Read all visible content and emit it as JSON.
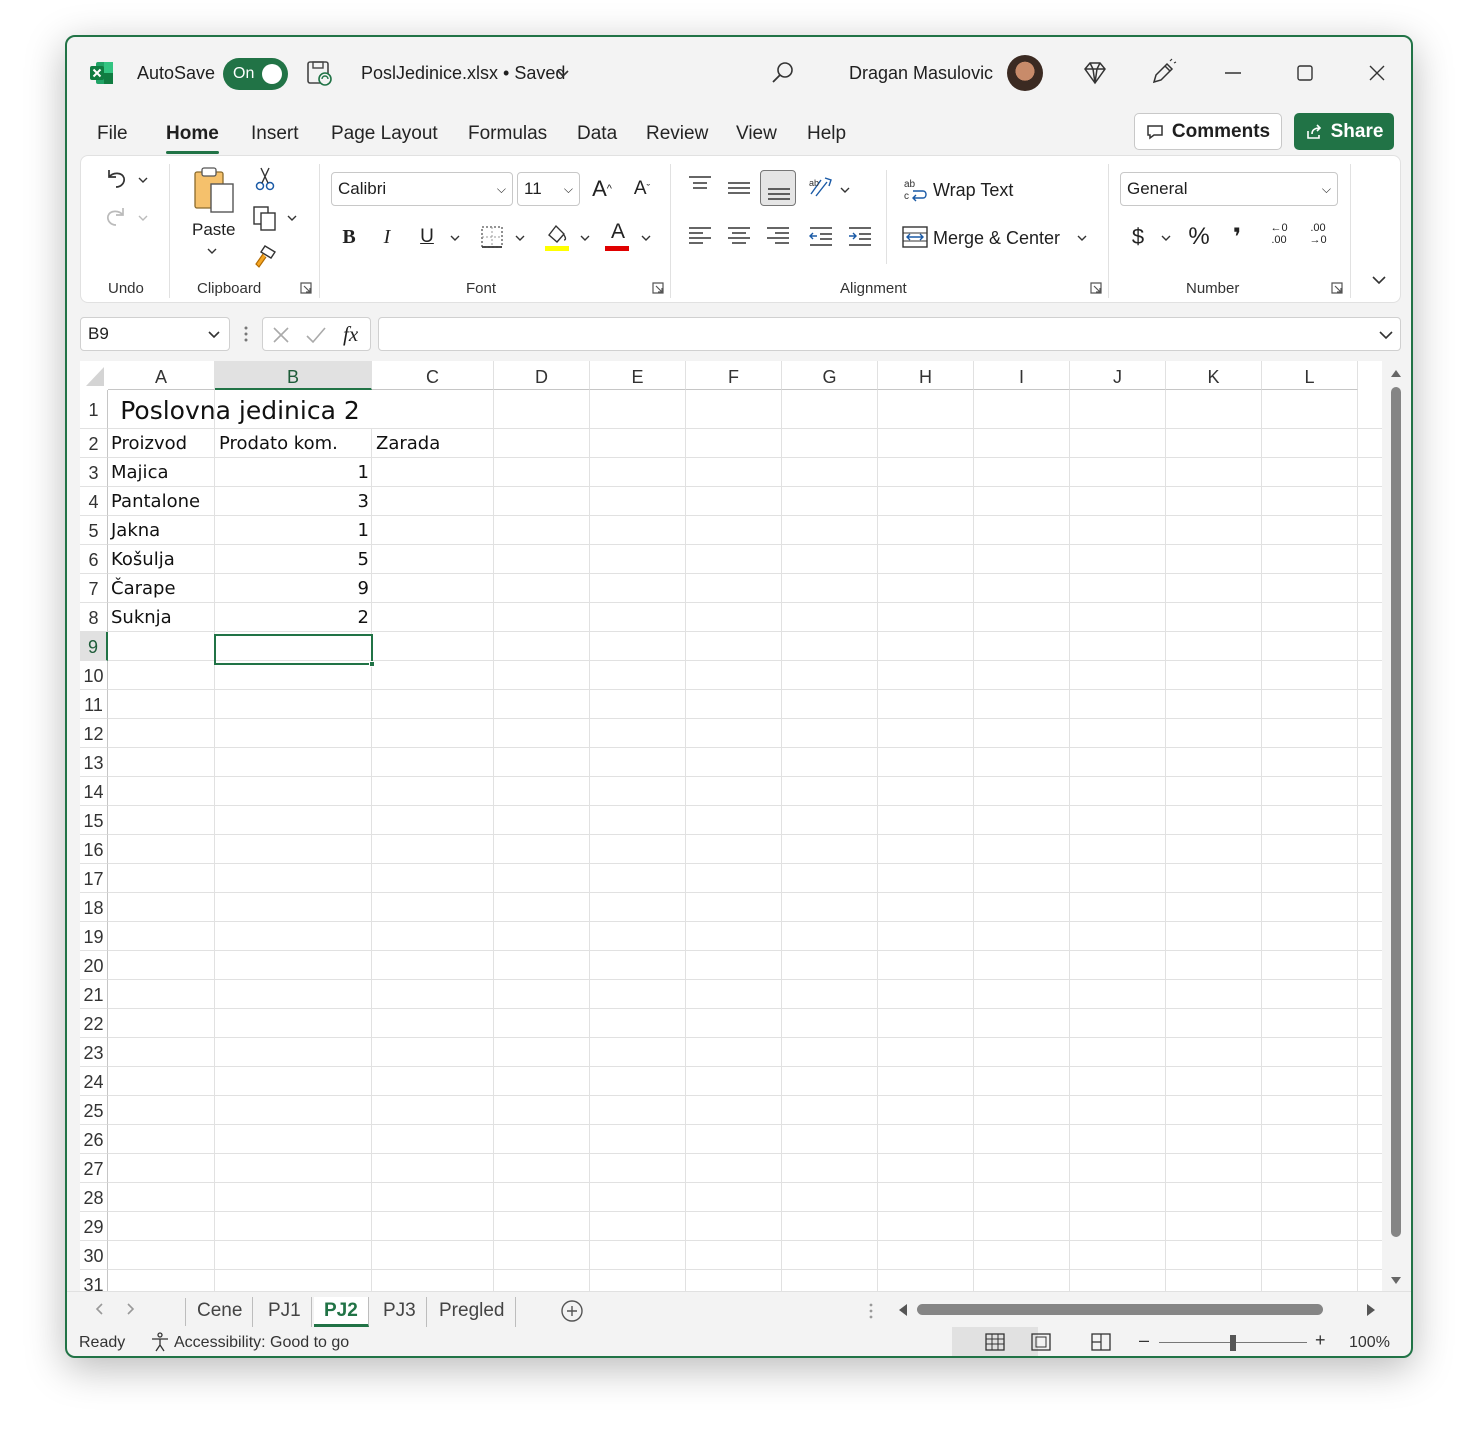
{
  "titlebar": {
    "autosave_label": "AutoSave",
    "toggle_state": "On",
    "filename": "PoslJedinice.xlsx • Saved",
    "user_name": "Dragan Masulovic"
  },
  "menu": {
    "tabs": [
      {
        "label": "File"
      },
      {
        "label": "Home"
      },
      {
        "label": "Insert"
      },
      {
        "label": "Page Layout"
      },
      {
        "label": "Formulas"
      },
      {
        "label": "Data"
      },
      {
        "label": "Review"
      },
      {
        "label": "View"
      },
      {
        "label": "Help"
      }
    ],
    "active_tab": "Home",
    "comments_label": "Comments",
    "share_label": "Share"
  },
  "ribbon": {
    "groups": {
      "undo": "Undo",
      "clipboard": "Clipboard",
      "font": "Font",
      "alignment": "Alignment",
      "number": "Number"
    },
    "paste_label": "Paste",
    "font_name": "Calibri",
    "font_size": "11",
    "wrap_text": "Wrap Text",
    "merge_center": "Merge & Center",
    "number_format": "General",
    "bold": "B",
    "italic": "I",
    "underline": "U",
    "currency": "$",
    "percent": "%",
    "comma": "❜",
    "font_grow": "A",
    "font_shrink": "A",
    "font_color_letter": "A",
    "dec_increase_top": "←0",
    "dec_increase_bottom": ".00",
    "dec_decrease_top": ".00",
    "dec_decrease_bottom": "→0",
    "highlight_color": "#ffff00",
    "font_color": "#e00000"
  },
  "formula_bar": {
    "name_box": "B9",
    "fx": "fx",
    "formula": ""
  },
  "sheet": {
    "columns": [
      "A",
      "B",
      "C",
      "D",
      "E",
      "F",
      "G",
      "H",
      "I",
      "J",
      "K",
      "L"
    ],
    "selected_column": "B",
    "rows": [
      "1",
      "2",
      "3",
      "4",
      "5",
      "6",
      "7",
      "8",
      "9",
      "10",
      "11",
      "12",
      "13",
      "14",
      "15",
      "16",
      "17",
      "18",
      "19",
      "20",
      "21",
      "22",
      "23",
      "24",
      "25",
      "26",
      "27",
      "28",
      "29",
      "30",
      "31"
    ],
    "selected_row": "9",
    "title": "Poslovna jedinica 2",
    "headers": [
      "Proizvod",
      "Prodato kom.",
      "Zarada"
    ],
    "data": [
      {
        "product": "Majica",
        "qty": "1"
      },
      {
        "product": "Pantalone",
        "qty": "3"
      },
      {
        "product": "Jakna",
        "qty": "1"
      },
      {
        "product": "Košulja",
        "qty": "5"
      },
      {
        "product": "Čarape",
        "qty": "9"
      },
      {
        "product": "Suknja",
        "qty": "2"
      }
    ]
  },
  "sheet_tabs": [
    "Cene",
    "PJ1",
    "PJ2",
    "PJ3",
    "Pregled"
  ],
  "active_sheet": "PJ2",
  "status": {
    "ready": "Ready",
    "accessibility": "Accessibility: Good to go",
    "zoom": "100%",
    "zoom_level": 100
  },
  "colors": {
    "accent": "#217346"
  }
}
